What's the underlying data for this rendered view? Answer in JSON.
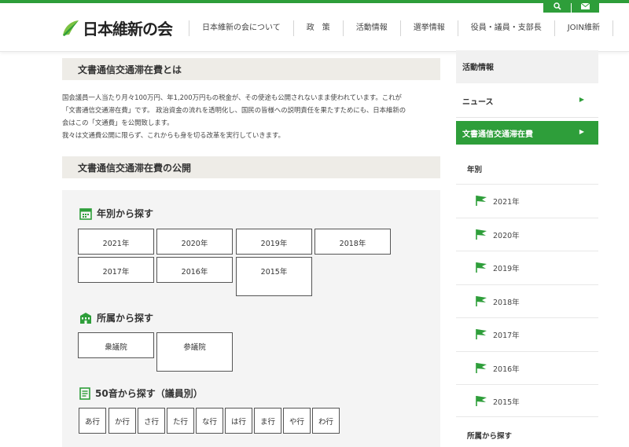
{
  "header": {
    "logo_text": "日本維新の会",
    "nav": [
      "日本維新の会について",
      "政　策",
      "活動情報",
      "選挙情報",
      "役員・議員・支部長",
      "JOIN維新"
    ],
    "accent": "#2e9e3a"
  },
  "main": {
    "section1_title": "文書通信交通滞在費とは",
    "intro_lines": [
      "国会議員一人当たり月々100万円、年1,200万円もの税金が、その使途も公開されないまま使われています。これが",
      "「文書通信交通滞在費」です。 政治資金の流れを透明化し、国民の皆様への説明責任を果たすためにも、日本維新の",
      "会はこの「文通費」を公開致します。",
      "我々は文通費公開に限らず、これからも身を切る改革を実行していきます。"
    ],
    "section2_title": "文書通信交通滞在費の公開",
    "by_year_title": "年別から探す",
    "years": [
      "2021年",
      "2020年",
      "2019年",
      "2018年",
      "2017年",
      "2016年",
      "2015年"
    ],
    "by_affiliation_title": "所属から探す",
    "affiliations": [
      "衆議院",
      "参議院"
    ],
    "by_kana_title": "50音から探す（議員別）",
    "kana": [
      "あ行",
      "か行",
      "さ行",
      "た行",
      "な行",
      "は行",
      "ま行",
      "や行",
      "わ行"
    ]
  },
  "sidebar": {
    "top_label": "活動情報",
    "news_label": "ニュース",
    "active_label": "文書通信交通滞在費",
    "year_heading": "年別",
    "years": [
      "2021年",
      "2020年",
      "2019年",
      "2018年",
      "2017年",
      "2016年",
      "2015年"
    ],
    "affiliation_heading": "所属から探す"
  }
}
